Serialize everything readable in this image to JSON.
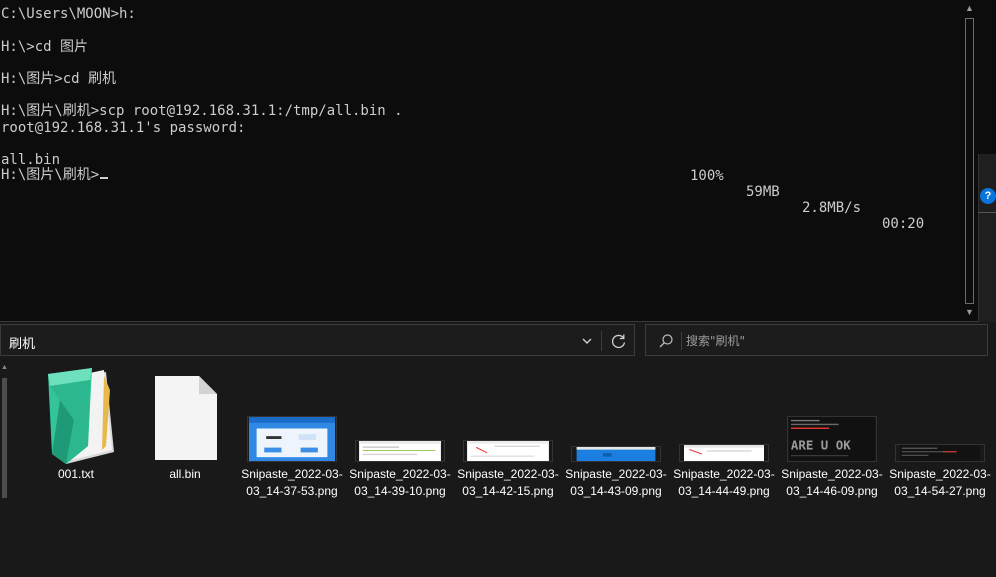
{
  "terminal": {
    "lines": [
      "C:\\Users\\MOON>h:",
      "H:\\>cd 图片",
      "H:\\图片>cd 刷机",
      "H:\\图片\\刷机>scp root@192.168.31.1:/tmp/all.bin .",
      "root@192.168.31.1's password:"
    ],
    "progress": {
      "file": "all.bin",
      "percent": "100%",
      "size": "59MB",
      "rate": "2.8MB/s",
      "time": "00:20"
    },
    "prompt": "H:\\图片\\刷机>"
  },
  "explorer": {
    "address": "刷机",
    "search_placeholder": "搜索\"刷机\"",
    "files": [
      {
        "name": "001.txt",
        "icon": "notepad-icon"
      },
      {
        "name": "all.bin",
        "icon": "blank-file-icon"
      },
      {
        "name": "Snipaste_2022-03-03_14-37-53.png",
        "icon": "image-thumbnail"
      },
      {
        "name": "Snipaste_2022-03-03_14-39-10.png",
        "icon": "image-thumbnail"
      },
      {
        "name": "Snipaste_2022-03-03_14-42-15.png",
        "icon": "image-thumbnail"
      },
      {
        "name": "Snipaste_2022-03-03_14-43-09.png",
        "icon": "image-thumbnail"
      },
      {
        "name": "Snipaste_2022-03-03_14-44-49.png",
        "icon": "image-thumbnail"
      },
      {
        "name": "Snipaste_2022-03-03_14-46-09.png",
        "icon": "image-thumbnail"
      },
      {
        "name": "Snipaste_2022-03-03_14-54-27.png",
        "icon": "image-thumbnail"
      }
    ],
    "thumb_text": "ARE U OK"
  },
  "colors": {
    "terminal_bg": "#0c0c0c",
    "terminal_fg": "#cccccc",
    "explorer_bg": "#191919",
    "accent_blue": "#1a7fe0"
  }
}
